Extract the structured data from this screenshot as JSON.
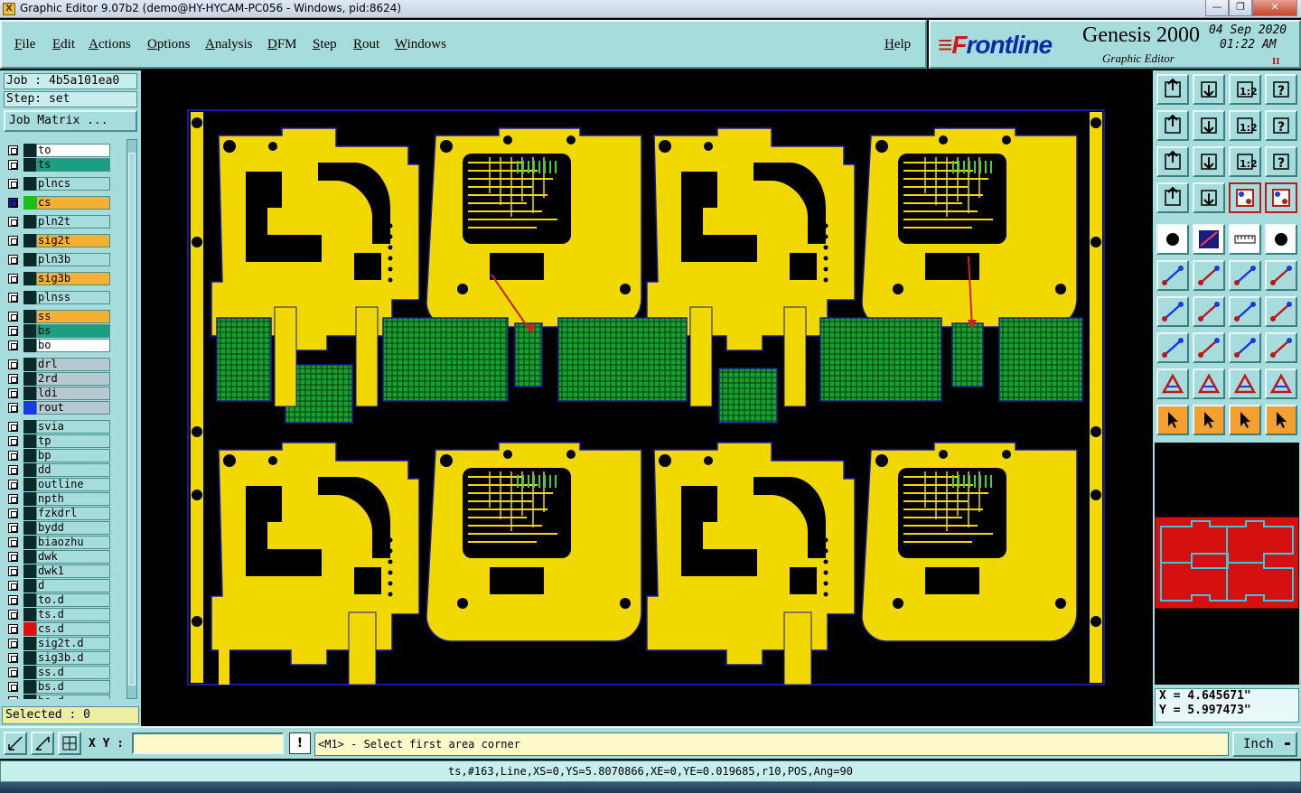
{
  "window": {
    "title": "Graphic Editor 9.07b2 (demo@HY-HYCAM-PC056 - Windows, pid:8624)",
    "min_glyph": "—",
    "max_glyph": "❐",
    "close_glyph": "✕"
  },
  "menu": {
    "items": [
      "File",
      "Edit",
      "Actions",
      "Options",
      "Analysis",
      "DFM",
      "Step",
      "Rout",
      "Windows"
    ],
    "help": "Help"
  },
  "brand": {
    "logo_f": "≡F",
    "logo_rest": "rontline",
    "product": "Genesis 2000",
    "subtitle": "Graphic Editor",
    "date": "04 Sep 2020",
    "time": "01:22 AM",
    "rec": "II"
  },
  "left_panel": {
    "job": "Job : 4b5a101ea0",
    "step": "Step: set",
    "job_matrix": "Job Matrix ...",
    "layers": [
      {
        "name": "to",
        "color": "#ffffff"
      },
      {
        "name": "ts",
        "color": "#1aa080"
      },
      {
        "name": "plncs",
        "color": "#a7dcdc"
      },
      {
        "name": "cs",
        "color": "#f4b030",
        "active": true
      },
      {
        "name": "pln2t",
        "color": "#a7dcdc"
      },
      {
        "name": "sig2t",
        "color": "#f4b030"
      },
      {
        "name": "pln3b",
        "color": "#a7dcdc"
      },
      {
        "name": "sig3b",
        "color": "#f4b030"
      },
      {
        "name": "plnss",
        "color": "#a7dcdc"
      },
      {
        "name": "ss",
        "color": "#f4b030"
      },
      {
        "name": "bs",
        "color": "#1aa080"
      },
      {
        "name": "bo",
        "color": "#ffffff"
      },
      {
        "name": "drl",
        "color": "#b8c8d0"
      },
      {
        "name": "2rd",
        "color": "#b8c8d0"
      },
      {
        "name": "ldi",
        "color": "#b8c8d0"
      },
      {
        "name": "rout",
        "color": "#b8c8d0"
      },
      {
        "name": "svia",
        "color": "#a7dcdc"
      },
      {
        "name": "tp",
        "color": "#a7dcdc"
      },
      {
        "name": "bp",
        "color": "#a7dcdc"
      },
      {
        "name": "dd",
        "color": "#a7dcdc"
      },
      {
        "name": "outline",
        "color": "#a7dcdc"
      },
      {
        "name": "npth",
        "color": "#a7dcdc"
      },
      {
        "name": "fzkdrl",
        "color": "#a7dcdc"
      },
      {
        "name": "bydd",
        "color": "#a7dcdc"
      },
      {
        "name": "biaozhu",
        "color": "#a7dcdc"
      },
      {
        "name": "dwk",
        "color": "#a7dcdc"
      },
      {
        "name": "dwk1",
        "color": "#a7dcdc"
      },
      {
        "name": "d",
        "color": "#a7dcdc"
      },
      {
        "name": "to.d",
        "color": "#a7dcdc"
      },
      {
        "name": "ts.d",
        "color": "#a7dcdc"
      },
      {
        "name": "cs.d",
        "color": "#a7dcdc"
      },
      {
        "name": "sig2t.d",
        "color": "#a7dcdc"
      },
      {
        "name": "sig3b.d",
        "color": "#a7dcdc"
      },
      {
        "name": "ss.d",
        "color": "#a7dcdc"
      },
      {
        "name": "bs.d",
        "color": "#a7dcdc"
      },
      {
        "name": "bo.d",
        "color": "#a7dcdc"
      }
    ],
    "selected": "Selected : 0"
  },
  "colors": {
    "board_yellow": "#f0d800",
    "outline_blue": "#1a1aa0",
    "grid_green": "#18a030",
    "trace_dark": "#000000"
  },
  "coords": {
    "x": "X = 4.645671\"",
    "y": "Y = 5.997473\""
  },
  "bottom": {
    "xy_label": "X Y :",
    "xy_value": "",
    "bang": "!",
    "prompt": "<M1> - Select first area corner",
    "units": "Inch",
    "units_arrow": "▬"
  },
  "status": "ts,#163,Line,XS=0,YS=5.8070866,XE=0,YE=0.019685,r10,POS,Ang=90"
}
